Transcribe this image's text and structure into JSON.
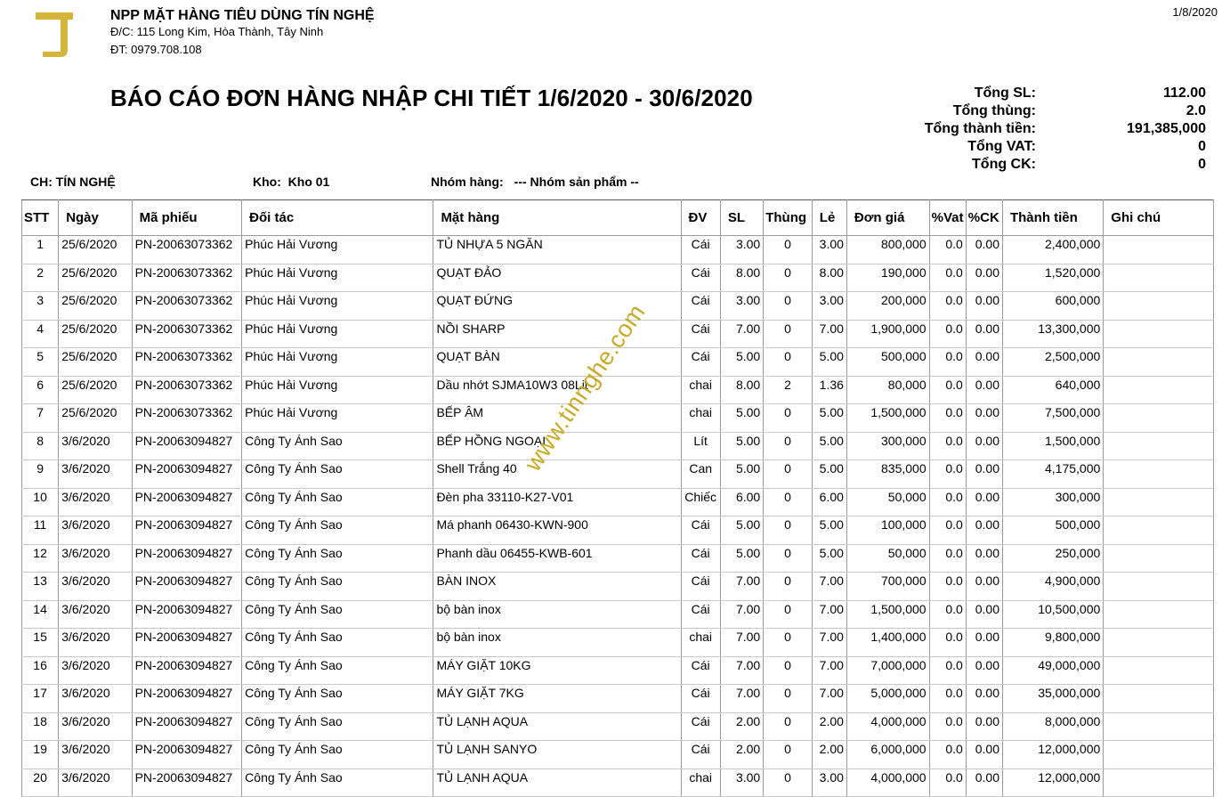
{
  "header": {
    "company_name": "NPP MẶT HÀNG TIÊU DÙNG TÍN NGHỆ",
    "address": "Đ/C: 115 Long Kim, Hòa Thành, Tây Ninh",
    "phone": "ĐT: 0979.708.108",
    "print_date": "1/8/2020",
    "logo_color": "#d4b43b"
  },
  "title": "BÁO CÁO ĐƠN HÀNG NHẬP CHI TIẾT 1/6/2020 - 30/6/2020",
  "totals": [
    {
      "label": "Tổng SL:",
      "value": "112.00"
    },
    {
      "label": "Tổng thùng:",
      "value": "2.0"
    },
    {
      "label": "Tổng thành tiền:",
      "value": "191,385,000"
    },
    {
      "label": "Tổng VAT:",
      "value": "0"
    },
    {
      "label": "Tổng CK:",
      "value": "0"
    }
  ],
  "filters": {
    "ch": "CH: TÍN NGHỆ",
    "kho_label": "Kho:",
    "kho_value": "Kho 01",
    "group_label": "Nhóm hàng:",
    "group_value": "--- Nhóm sản phẩm --"
  },
  "table": {
    "columns": [
      "STT",
      "Ngày",
      "Mã phiếu",
      "Đối tác",
      "Mặt hàng",
      "ĐV",
      "SL",
      "Thùng",
      "Lẻ",
      "Đơn giá",
      "%Vat",
      "%CK",
      "Thành tiền",
      "Ghi chú"
    ],
    "rows": [
      [
        "1",
        "25/6/2020",
        "PN-20063073362",
        "Phúc Hải Vương",
        "TỦ NHỰA 5 NGĂN",
        "Cái",
        "3.00",
        "0",
        "3.00",
        "800,000",
        "0.0",
        "0.00",
        "2,400,000",
        ""
      ],
      [
        "2",
        "25/6/2020",
        "PN-20063073362",
        "Phúc Hải Vương",
        "QUẠT ĐẢO",
        "Cái",
        "8.00",
        "0",
        "8.00",
        "190,000",
        "0.0",
        "0.00",
        "1,520,000",
        ""
      ],
      [
        "3",
        "25/6/2020",
        "PN-20063073362",
        "Phúc Hải Vương",
        "QUẠT ĐỨNG",
        "Cái",
        "3.00",
        "0",
        "3.00",
        "200,000",
        "0.0",
        "0.00",
        "600,000",
        ""
      ],
      [
        "4",
        "25/6/2020",
        "PN-20063073362",
        "Phúc Hải Vương",
        "NỒI SHARP",
        "Cái",
        "7.00",
        "0",
        "7.00",
        "1,900,000",
        "0.0",
        "0.00",
        "13,300,000",
        ""
      ],
      [
        "5",
        "25/6/2020",
        "PN-20063073362",
        "Phúc Hải Vương",
        "QUẠT BÀN",
        "Cái",
        "5.00",
        "0",
        "5.00",
        "500,000",
        "0.0",
        "0.00",
        "2,500,000",
        ""
      ],
      [
        "6",
        "25/6/2020",
        "PN-20063073362",
        "Phúc Hải Vương",
        "Dầu nhớt SJMA10W3 08Lit",
        "chai",
        "8.00",
        "2",
        "1.36",
        "80,000",
        "0.0",
        "0.00",
        "640,000",
        ""
      ],
      [
        "7",
        "25/6/2020",
        "PN-20063073362",
        "Phúc Hải Vương",
        "BẾP ÂM",
        "chai",
        "5.00",
        "0",
        "5.00",
        "1,500,000",
        "0.0",
        "0.00",
        "7,500,000",
        ""
      ],
      [
        "8",
        "3/6/2020",
        "PN-20063094827",
        "Công Ty Ánh Sao",
        "BẾP HỒNG NGOẠI",
        "Lít",
        "5.00",
        "0",
        "5.00",
        "300,000",
        "0.0",
        "0.00",
        "1,500,000",
        ""
      ],
      [
        "9",
        "3/6/2020",
        "PN-20063094827",
        "Công Ty Ánh Sao",
        "Shell Trắng 40",
        "Can",
        "5.00",
        "0",
        "5.00",
        "835,000",
        "0.0",
        "0.00",
        "4,175,000",
        ""
      ],
      [
        "10",
        "3/6/2020",
        "PN-20063094827",
        "Công Ty Ánh Sao",
        "Đèn pha 33110-K27-V01",
        "Chiếc",
        "6.00",
        "0",
        "6.00",
        "50,000",
        "0.0",
        "0.00",
        "300,000",
        ""
      ],
      [
        "11",
        "3/6/2020",
        "PN-20063094827",
        "Công Ty Ánh Sao",
        "Má phanh 06430-KWN-900",
        "Cái",
        "5.00",
        "0",
        "5.00",
        "100,000",
        "0.0",
        "0.00",
        "500,000",
        ""
      ],
      [
        "12",
        "3/6/2020",
        "PN-20063094827",
        "Công Ty Ánh Sao",
        "Phanh dầu 06455-KWB-601",
        "Cái",
        "5.00",
        "0",
        "5.00",
        "50,000",
        "0.0",
        "0.00",
        "250,000",
        ""
      ],
      [
        "13",
        "3/6/2020",
        "PN-20063094827",
        "Công Ty Ánh Sao",
        "BÀN INOX",
        "Cái",
        "7.00",
        "0",
        "7.00",
        "700,000",
        "0.0",
        "0.00",
        "4,900,000",
        ""
      ],
      [
        "14",
        "3/6/2020",
        "PN-20063094827",
        "Công Ty Ánh Sao",
        "bộ bàn inox",
        "Cái",
        "7.00",
        "0",
        "7.00",
        "1,500,000",
        "0.0",
        "0.00",
        "10,500,000",
        ""
      ],
      [
        "15",
        "3/6/2020",
        "PN-20063094827",
        "Công Ty Ánh Sao",
        "bộ bàn inox",
        "chai",
        "7.00",
        "0",
        "7.00",
        "1,400,000",
        "0.0",
        "0.00",
        "9,800,000",
        ""
      ],
      [
        "16",
        "3/6/2020",
        "PN-20063094827",
        "Công Ty Ánh Sao",
        "MÁY GIẶT 10KG",
        "Cái",
        "7.00",
        "0",
        "7.00",
        "7,000,000",
        "0.0",
        "0.00",
        "49,000,000",
        ""
      ],
      [
        "17",
        "3/6/2020",
        "PN-20063094827",
        "Công Ty Ánh Sao",
        "MÁY GIẶT 7KG",
        "Cái",
        "7.00",
        "0",
        "7.00",
        "5,000,000",
        "0.0",
        "0.00",
        "35,000,000",
        ""
      ],
      [
        "18",
        "3/6/2020",
        "PN-20063094827",
        "Công Ty Ánh Sao",
        "TỦ LẠNH AQUA",
        "Cái",
        "2.00",
        "0",
        "2.00",
        "4,000,000",
        "0.0",
        "0.00",
        "8,000,000",
        ""
      ],
      [
        "19",
        "3/6/2020",
        "PN-20063094827",
        "Công Ty Ánh Sao",
        "TỦ LẠNH SANYO",
        "Cái",
        "2.00",
        "0",
        "2.00",
        "6,000,000",
        "0.0",
        "0.00",
        "12,000,000",
        ""
      ],
      [
        "20",
        "3/6/2020",
        "PN-20063094827",
        "Công Ty Ánh Sao",
        "TỦ LẠNH AQUA",
        "chai",
        "3.00",
        "0",
        "3.00",
        "4,000,000",
        "0.0",
        "0.00",
        "12,000,000",
        ""
      ]
    ]
  },
  "watermark": "www.tinnghe.com"
}
